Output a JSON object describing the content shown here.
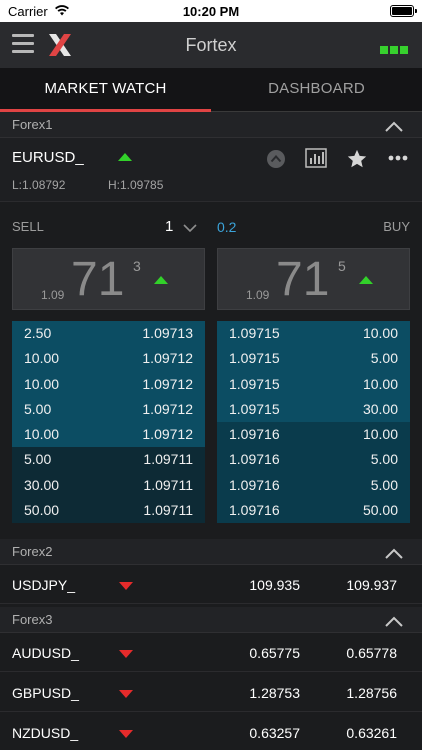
{
  "status_bar": {
    "carrier": "Carrier",
    "time": "10:20 PM"
  },
  "header": {
    "title": "Fortex",
    "menu_icon": "hamburger-icon",
    "logo_icon": "x-logo-icon",
    "connection_icon": "connection-status-icon"
  },
  "tabs": [
    {
      "label": "MARKET WATCH",
      "active": true
    },
    {
      "label": "DASHBOARD",
      "active": false
    }
  ],
  "groups": [
    {
      "name": "Forex1"
    },
    {
      "name": "Forex2"
    },
    {
      "name": "Forex3"
    }
  ],
  "expanded": {
    "symbol": "EURUSD_",
    "low": "L:1.08792",
    "high": "H:1.09785",
    "sell_label": "SELL",
    "buy_label": "BUY",
    "quantity": "1",
    "spread": "0.2",
    "sell_tile": {
      "prefix": "1.09",
      "big": "71",
      "sup": "3"
    },
    "buy_tile": {
      "prefix": "1.09",
      "big": "71",
      "sup": "5"
    },
    "bids": [
      {
        "size": "2.50",
        "price": "1.09713"
      },
      {
        "size": "10.00",
        "price": "1.09712"
      },
      {
        "size": "10.00",
        "price": "1.09712"
      },
      {
        "size": "5.00",
        "price": "1.09712"
      },
      {
        "size": "10.00",
        "price": "1.09712"
      },
      {
        "size": "5.00",
        "price": "1.09711"
      },
      {
        "size": "30.00",
        "price": "1.09711"
      },
      {
        "size": "50.00",
        "price": "1.09711"
      }
    ],
    "asks": [
      {
        "price": "1.09715",
        "size": "10.00"
      },
      {
        "price": "1.09715",
        "size": "5.00"
      },
      {
        "price": "1.09715",
        "size": "10.00"
      },
      {
        "price": "1.09715",
        "size": "30.00"
      },
      {
        "price": "1.09716",
        "size": "10.00"
      },
      {
        "price": "1.09716",
        "size": "5.00"
      },
      {
        "price": "1.09716",
        "size": "5.00"
      },
      {
        "price": "1.09716",
        "size": "50.00"
      }
    ]
  },
  "forex2": [
    {
      "symbol": "USDJPY_",
      "bid": "109.935",
      "ask": "109.937"
    }
  ],
  "forex3": [
    {
      "symbol": "AUDUSD_",
      "bid": "0.65775",
      "ask": "0.65778"
    },
    {
      "symbol": "GBPUSD_",
      "bid": "1.28753",
      "ask": "1.28756"
    },
    {
      "symbol": "NZDUSD_",
      "bid": "0.63257",
      "ask": "0.63261"
    }
  ],
  "colors": {
    "up": "#32d12a",
    "down": "#e62b2b",
    "accent": "#e04444",
    "spread": "#3ba3d9",
    "connected": "#37d12e"
  }
}
